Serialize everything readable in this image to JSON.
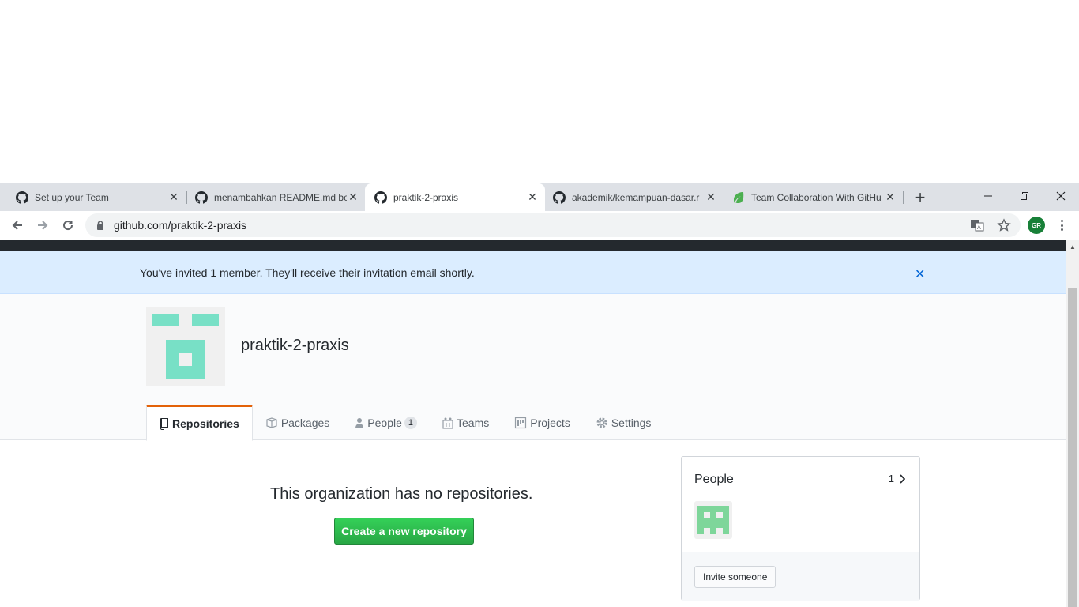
{
  "browser": {
    "tabs": [
      {
        "title": "Set up your Team",
        "icon": "github-icon"
      },
      {
        "title": "menambahkan README.md be",
        "icon": "github-icon"
      },
      {
        "title": "praktik-2-praxis",
        "icon": "github-icon",
        "active": true
      },
      {
        "title": "akademik/kemampuan-dasar.r",
        "icon": "github-icon"
      },
      {
        "title": "Team Collaboration With GitHu",
        "icon": "leaf-icon"
      }
    ],
    "address": "github.com/praktik-2-praxis",
    "profile_initials": "GR"
  },
  "flash": {
    "message": "You've invited 1 member. They'll receive their invitation email shortly."
  },
  "org": {
    "name": "praktik-2-praxis",
    "tabs": [
      {
        "label": "Repositories",
        "icon": "repo-icon"
      },
      {
        "label": "Packages",
        "icon": "package-icon"
      },
      {
        "label": "People",
        "icon": "person-icon",
        "count": "1"
      },
      {
        "label": "Teams",
        "icon": "team-icon"
      },
      {
        "label": "Projects",
        "icon": "project-icon"
      },
      {
        "label": "Settings",
        "icon": "gear-icon"
      }
    ]
  },
  "main": {
    "blankslate": "This organization has no repositories.",
    "create_button": "Create a new repository"
  },
  "people_box": {
    "title": "People",
    "count": "1",
    "invite_button": "Invite someone"
  },
  "colors": {
    "accent_orange": "#e36209",
    "flash_bg": "#dbedff",
    "green_button": "#28a745",
    "identicon": "#78e0c6"
  }
}
